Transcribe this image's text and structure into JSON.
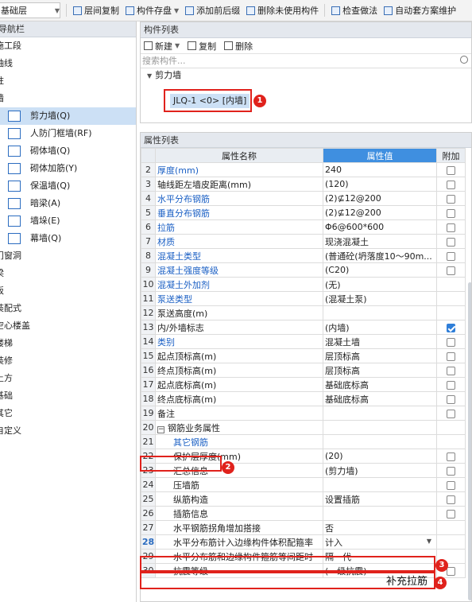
{
  "toolbar": {
    "floor_combo": "基础层",
    "items": [
      "层间复制",
      "构件存盘",
      "添加前后缀",
      "删除未使用构件",
      "检查做法",
      "自动套方案维护"
    ]
  },
  "nav": {
    "title": "导航栏",
    "items": [
      {
        "label": "施工段",
        "sub": false
      },
      {
        "label": "轴线",
        "sub": false
      },
      {
        "label": "柱",
        "sub": false
      },
      {
        "label": "墙",
        "sub": false
      },
      {
        "label": "剪力墙(Q)",
        "sub": true,
        "icon": "shear-wall-icon",
        "selected": true
      },
      {
        "label": "人防门框墙(RF)",
        "sub": true,
        "icon": "civil-defense-wall-icon"
      },
      {
        "label": "砌体墙(Q)",
        "sub": true,
        "icon": "masonry-wall-icon"
      },
      {
        "label": "砌体加筋(Y)",
        "sub": true,
        "icon": "masonry-rebar-icon"
      },
      {
        "label": "保温墙(Q)",
        "sub": true,
        "icon": "insulation-wall-icon"
      },
      {
        "label": "暗梁(A)",
        "sub": true,
        "icon": "hidden-beam-icon"
      },
      {
        "label": "墙垛(E)",
        "sub": true,
        "icon": "wall-pier-icon"
      },
      {
        "label": "幕墙(Q)",
        "sub": true,
        "icon": "curtain-wall-icon"
      },
      {
        "label": "门窗洞",
        "sub": false
      },
      {
        "label": "梁",
        "sub": false
      },
      {
        "label": "板",
        "sub": false
      },
      {
        "label": "装配式",
        "sub": false
      },
      {
        "label": "空心楼盖",
        "sub": false
      },
      {
        "label": "楼梯",
        "sub": false
      },
      {
        "label": "装修",
        "sub": false
      },
      {
        "label": "土方",
        "sub": false
      },
      {
        "label": "基础",
        "sub": false
      },
      {
        "label": "其它",
        "sub": false
      },
      {
        "label": "自定义",
        "sub": false
      }
    ]
  },
  "components": {
    "title": "构件列表",
    "new_label": "新建",
    "copy_label": "复制",
    "delete_label": "删除",
    "search_placeholder": "搜索构件...",
    "group": "剪力墙",
    "selected_item": "JLQ-1 <0> [内墙]"
  },
  "props": {
    "title": "属性列表",
    "col_name": "属性名称",
    "col_value": "属性值",
    "col_extra": "附加",
    "rows": [
      {
        "n": "2",
        "name": "厚度(mm)",
        "value": "240",
        "link": true,
        "chk": "off"
      },
      {
        "n": "3",
        "name": "轴线距左墙皮距离(mm)",
        "value": "(120)",
        "link": false,
        "chk": "off"
      },
      {
        "n": "4",
        "name": "水平分布钢筋",
        "value": "(2)⊈12@200",
        "link": true,
        "chk": "off"
      },
      {
        "n": "5",
        "name": "垂直分布钢筋",
        "value": "(2)⊈12@200",
        "link": true,
        "chk": "off"
      },
      {
        "n": "6",
        "name": "拉筋",
        "value": "Φ6@600*600",
        "link": true,
        "chk": "off"
      },
      {
        "n": "7",
        "name": "材质",
        "value": "现浇混凝土",
        "link": true,
        "chk": "off"
      },
      {
        "n": "8",
        "name": "混凝土类型",
        "value": "(普通砼(坍落度10～90m...",
        "link": true,
        "chk": "off"
      },
      {
        "n": "9",
        "name": "混凝土强度等级",
        "value": "(C20)",
        "link": true,
        "chk": "off"
      },
      {
        "n": "10",
        "name": "混凝土外加剂",
        "value": "(无)",
        "link": true,
        "chk": "none"
      },
      {
        "n": "11",
        "name": "泵送类型",
        "value": "(混凝土泵)",
        "link": true,
        "chk": "none"
      },
      {
        "n": "12",
        "name": "泵送高度(m)",
        "value": "",
        "link": false,
        "chk": "none"
      },
      {
        "n": "13",
        "name": "内/外墙标志",
        "value": "(内墙)",
        "link": false,
        "chk": "on"
      },
      {
        "n": "14",
        "name": "类别",
        "value": "混凝土墙",
        "link": true,
        "chk": "off"
      },
      {
        "n": "15",
        "name": "起点顶标高(m)",
        "value": "层顶标高",
        "link": false,
        "chk": "off"
      },
      {
        "n": "16",
        "name": "终点顶标高(m)",
        "value": "层顶标高",
        "link": false,
        "chk": "off"
      },
      {
        "n": "17",
        "name": "起点底标高(m)",
        "value": "基础底标高",
        "link": false,
        "chk": "off"
      },
      {
        "n": "18",
        "name": "终点底标高(m)",
        "value": "基础底标高",
        "link": false,
        "chk": "off"
      },
      {
        "n": "19",
        "name": "备注",
        "value": "",
        "link": false,
        "chk": "off"
      },
      {
        "n": "20",
        "name": "钢筋业务属性",
        "value": "",
        "link": false,
        "chk": "none",
        "group": true
      },
      {
        "n": "21",
        "name": "其它钢筋",
        "value": "",
        "link": true,
        "chk": "none",
        "indent": true
      },
      {
        "n": "22",
        "name": "保护层厚度(mm)",
        "value": "(20)",
        "link": false,
        "chk": "off",
        "indent": true
      },
      {
        "n": "23",
        "name": "汇总信息",
        "value": "(剪力墙)",
        "link": false,
        "chk": "off",
        "indent": true
      },
      {
        "n": "24",
        "name": "压墙筋",
        "value": "",
        "link": false,
        "chk": "off",
        "indent": true
      },
      {
        "n": "25",
        "name": "纵筋构造",
        "value": "设置插筋",
        "link": false,
        "chk": "off",
        "indent": true
      },
      {
        "n": "26",
        "name": "插筋信息",
        "value": "",
        "link": false,
        "chk": "off",
        "indent": true
      },
      {
        "n": "27",
        "name": "水平钢筋拐角增加搭接",
        "value": "否",
        "link": false,
        "chk": "none",
        "indent": true
      },
      {
        "n": "28",
        "name": "水平分布筋计入边缘构件体积配箍率",
        "value": "计入",
        "link": false,
        "chk": "none",
        "indent": true,
        "active": true,
        "dropdown": true
      },
      {
        "n": "29",
        "name": "水平分布筋和边缘构件箍筋等间距时",
        "value": "隔一代一",
        "link": false,
        "chk": "none",
        "indent": true
      },
      {
        "n": "30",
        "name": "抗震等级",
        "value": "(一级抗震)",
        "link": false,
        "chk": "off",
        "indent": true
      }
    ]
  },
  "annotations": {
    "marker1": "1",
    "marker2": "2",
    "marker3": "3",
    "marker4": "4",
    "extra_note": "补充拉筋"
  }
}
